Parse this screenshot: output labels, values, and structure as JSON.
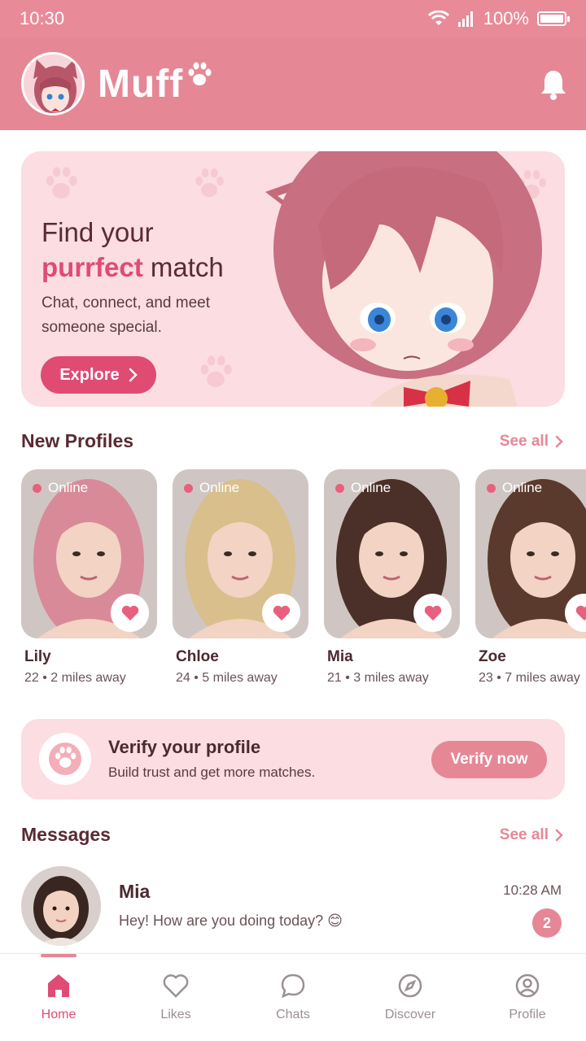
{
  "status_bar": {
    "time": "10:30",
    "battery": "100%",
    "battery_level": 1.0
  },
  "header": {
    "app_name": "Muff"
  },
  "hero": {
    "title_line1": "Find your",
    "title_accent": "purrfect",
    "title_rest": " match",
    "subtitle": "Chat, connect, and meet someone special.",
    "button_label": "Explore"
  },
  "new_profiles": {
    "title": "New Profiles",
    "see_all": "See all",
    "items": [
      {
        "status": "Online",
        "name": "Lily",
        "meta": "22 • 2 miles away",
        "hair": "#d98a98"
      },
      {
        "status": "Online",
        "name": "Chloe",
        "meta": "24 • 5 miles away",
        "hair": "#d9bf8c"
      },
      {
        "status": "Online",
        "name": "Mia",
        "meta": "21 • 3 miles away",
        "hair": "#4a3028"
      },
      {
        "status": "Online",
        "name": "Zoe",
        "meta": "23 • 7 miles away",
        "hair": "#5a3a2c"
      }
    ]
  },
  "verify": {
    "title": "Verify your profile",
    "subtitle": "Build trust and get more matches.",
    "button_label": "Verify now"
  },
  "messages": {
    "title": "Messages",
    "see_all": "See all",
    "items": [
      {
        "name": "Mia",
        "preview": "Hey! How are you doing today? 😊",
        "time": "10:28 AM",
        "unread": "2"
      }
    ]
  },
  "tabs": [
    {
      "label": "Home",
      "active": true
    },
    {
      "label": "Likes",
      "active": false
    },
    {
      "label": "Chats",
      "active": false
    },
    {
      "label": "Discover",
      "active": false
    },
    {
      "label": "Profile",
      "active": false
    }
  ],
  "colors": {
    "primary": "#e68796",
    "accent": "#e04b74",
    "card_bg": "#fbdde2"
  }
}
